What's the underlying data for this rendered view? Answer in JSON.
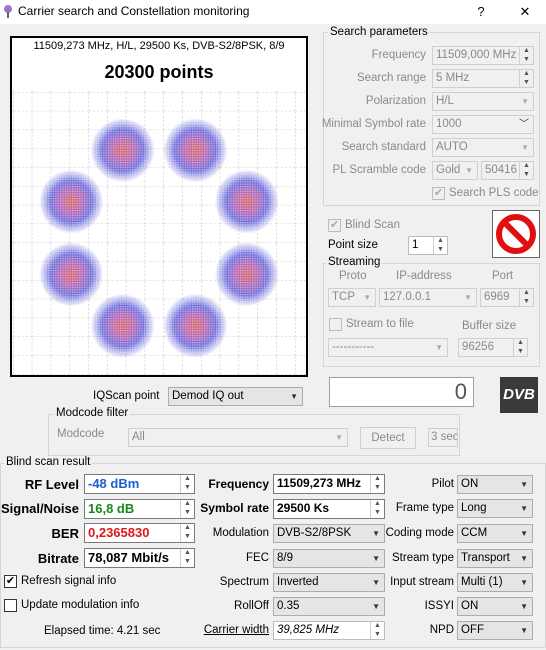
{
  "window": {
    "title": "Carrier search and Constellation monitoring",
    "help": "?",
    "close": "✕"
  },
  "constellation": {
    "info": "11509,273 MHz, H/L, 29500 Ks, DVB-S2/8PSK, 8/9",
    "points": "20300 points"
  },
  "search": {
    "title": "Search parameters",
    "frequency_label": "Frequency",
    "frequency_value": "11509,000 MHz",
    "range_label": "Search range",
    "range_value": "5 MHz",
    "polarization_label": "Polarization",
    "polarization_value": "H/L",
    "minsym_label": "Minimal Symbol rate",
    "minsym_value": "1000",
    "standard_label": "Search standard",
    "standard_value": "AUTO",
    "pl_label": "PL Scramble code",
    "pl_type": "Gold",
    "pl_value": "50416",
    "pls_label": "Search PLS code",
    "pls_checked": "✔"
  },
  "blind_scan": {
    "label": "Blind Scan",
    "checked": "✔"
  },
  "point_size": {
    "label": "Point size",
    "value": "1"
  },
  "streaming": {
    "title": "Streaming",
    "proto_label": "Proto",
    "ip_label": "IP-address",
    "port_label": "Port",
    "proto_value": "TCP",
    "ip_value": "127.0.0.1",
    "port_value": "6969",
    "to_file_label": "Stream to file",
    "buffer_label": "Buffer size",
    "file_value": "-----------",
    "buffer_value": "96256"
  },
  "counter": "0",
  "dvb_logo": "DVB",
  "iqscan": {
    "label": "IQScan point",
    "value": "Demod IQ out"
  },
  "modcode": {
    "title": "Modcode filter",
    "label": "Modcode",
    "value": "All",
    "detect": "Detect",
    "time": "3 sec"
  },
  "result": {
    "title": "Blind scan result",
    "rf_label": "RF Level",
    "rf_value": "-48 dBm",
    "rf_color": "#1a5fd1",
    "sn_label": "Signal/Noise",
    "sn_value": "16,8 dB",
    "sn_color": "#188a18",
    "ber_label": "BER",
    "ber_value": "0,2365830",
    "ber_color": "#e01818",
    "bitrate_label": "Bitrate",
    "bitrate_value": "78,087 Mbit/s",
    "freq_label": "Frequency",
    "freq_value": "11509,273 MHz",
    "sym_label": "Symbol rate",
    "sym_value": "29500 Ks",
    "mod_label": "Modulation",
    "mod_value": "DVB-S2/8PSK",
    "fec_label": "FEC",
    "fec_value": "8/9",
    "spec_label": "Spectrum",
    "spec_value": "Inverted",
    "roll_label": "RollOff",
    "roll_value": "0.35",
    "cw_label": "Carrier width",
    "cw_value": "39,825 MHz",
    "pilot_label": "Pilot",
    "pilot_value": "ON",
    "frame_label": "Frame type",
    "frame_value": "Long",
    "coding_label": "Coding mode",
    "coding_value": "CCM",
    "stype_label": "Stream type",
    "stype_value": "Transport",
    "istream_label": "Input stream",
    "istream_value": "Multi (1)",
    "issyi_label": "ISSYI",
    "issyi_value": "ON",
    "npd_label": "NPD",
    "npd_value": "OFF",
    "refresh_label": "Refresh signal info",
    "refresh_checked": "✔",
    "update_label": "Update modulation info",
    "elapsed": "Elapsed time: 4.21 sec"
  }
}
